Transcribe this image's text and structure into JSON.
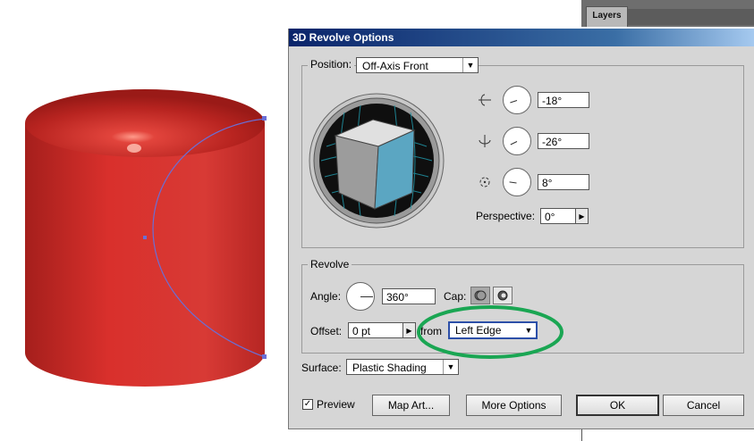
{
  "background_panel": {
    "layers_tab": "Layers"
  },
  "dialog": {
    "title": "3D Revolve Options",
    "position": {
      "group_label": "Position:",
      "preset_value": "Off-Axis Front",
      "rotate_x": "-18°",
      "rotate_y": "-26°",
      "rotate_z": "8°",
      "perspective_label": "Perspective:",
      "perspective_value": "0°"
    },
    "revolve": {
      "group_label": "Revolve",
      "angle_label": "Angle:",
      "angle_value": "360°",
      "cap_label": "Cap:",
      "offset_label": "Offset:",
      "offset_value": "0 pt",
      "from_label": "from",
      "from_value": "Left Edge"
    },
    "surface": {
      "label": "Surface:",
      "value": "Plastic Shading"
    },
    "preview": {
      "label": "Preview",
      "checked": true
    },
    "buttons": {
      "map_art": "Map Art...",
      "more_options": "More Options",
      "ok": "OK",
      "cancel": "Cancel"
    }
  },
  "colors": {
    "cylinder_red": "#d9302c",
    "path_blue": "#6a6fd6",
    "highlight_green": "#1aa653",
    "cube_front": "#5ba6c2",
    "title_bar": "#0a246a"
  }
}
